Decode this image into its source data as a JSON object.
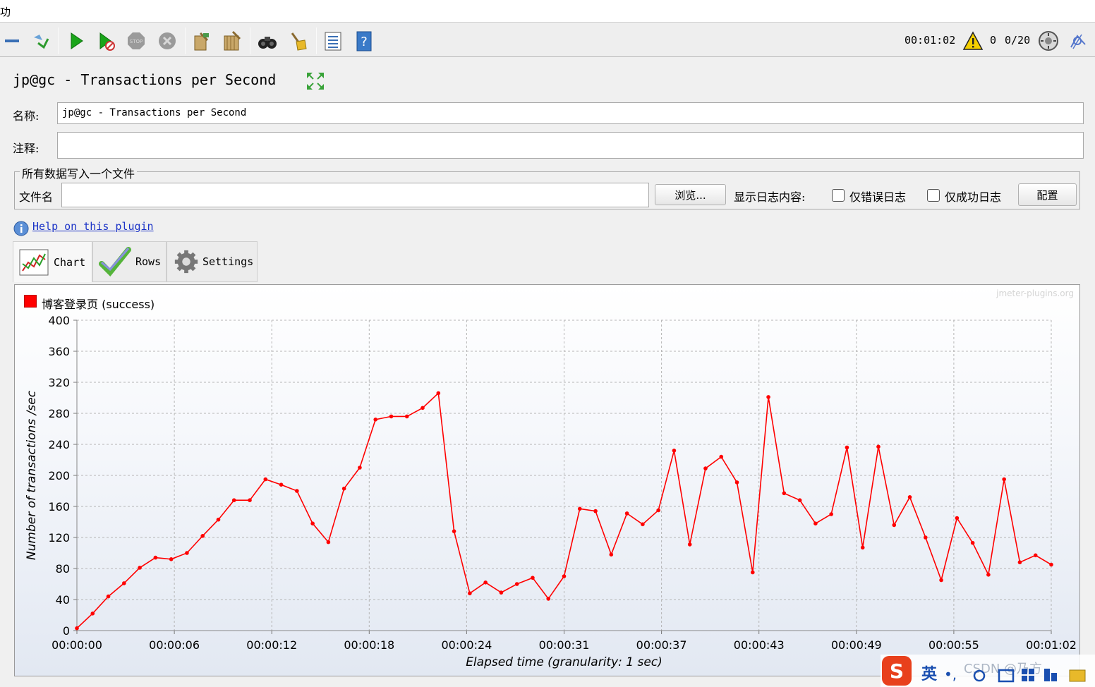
{
  "window": {
    "title_fragment": "功"
  },
  "toolbar": {
    "icons": [
      "collapse-icon",
      "toggle-icon",
      "start-icon",
      "start-no-pause-icon",
      "stop-icon",
      "shutdown-icon",
      "clear-icon",
      "clear-all-icon",
      "search-icon",
      "reset-search-icon",
      "function-helper-icon",
      "help-icon"
    ],
    "elapsed_time": "00:01:02",
    "warning_count": "0",
    "threads": "0/20"
  },
  "panel": {
    "title": "jp@gc - Transactions per Second",
    "name_label": "名称:",
    "name_value": "jp@gc - Transactions per Second",
    "comment_label": "注释:",
    "comment_value": ""
  },
  "file_group": {
    "legend": "所有数据写入一个文件",
    "filename_label": "文件名",
    "filename_value": "",
    "browse_label": "浏览...",
    "log_display_label": "显示日志内容:",
    "errors_only_label": "仅错误日志",
    "errors_only_checked": false,
    "success_only_label": "仅成功日志",
    "success_only_checked": false,
    "configure_label": "配置"
  },
  "help": {
    "link_text": "Help on this plugin"
  },
  "tabs": [
    {
      "label": "Chart",
      "icon": "chart-icon",
      "active": true
    },
    {
      "label": "Rows",
      "icon": "checkmark-icon",
      "active": false
    },
    {
      "label": "Settings",
      "icon": "gear-icon",
      "active": false
    }
  ],
  "chart_data": {
    "type": "line",
    "watermark": "jmeter-plugins.org",
    "xlabel": "Elapsed time (granularity: 1 sec)",
    "ylabel": "Number of transactions /sec",
    "ylim": [
      0,
      400
    ],
    "xlim": [
      0,
      62
    ],
    "y_ticks": [
      "0",
      "40",
      "80",
      "120",
      "160",
      "200",
      "240",
      "280",
      "320",
      "360",
      "400"
    ],
    "x_ticks": [
      {
        "x": 0,
        "label": "00:00:00"
      },
      {
        "x": 6.2,
        "label": "00:00:06"
      },
      {
        "x": 12.4,
        "label": "00:00:12"
      },
      {
        "x": 18.6,
        "label": "00:00:18"
      },
      {
        "x": 24.8,
        "label": "00:00:24"
      },
      {
        "x": 31,
        "label": "00:00:31"
      },
      {
        "x": 37.2,
        "label": "00:00:37"
      },
      {
        "x": 43.4,
        "label": "00:00:43"
      },
      {
        "x": 49.6,
        "label": "00:00:49"
      },
      {
        "x": 55.8,
        "label": "00:00:55"
      },
      {
        "x": 62,
        "label": "00:01:02"
      }
    ],
    "grid": true,
    "legend_position": "top-left",
    "series": [
      {
        "name": "博客登录页 (success)",
        "color": "#ff0000",
        "values": [
          3,
          22,
          44,
          61,
          81,
          94,
          92,
          100,
          122,
          143,
          168,
          168,
          195,
          188,
          180,
          138,
          114,
          183,
          210,
          272,
          276,
          276,
          287,
          306,
          128,
          48,
          62,
          49,
          60,
          68,
          41,
          70,
          157,
          154,
          98,
          151,
          137,
          155,
          232,
          111,
          209,
          224,
          191,
          75,
          301,
          177,
          168,
          138,
          150,
          236,
          107,
          237,
          136,
          172,
          120,
          65,
          145,
          113,
          72,
          195,
          88,
          97,
          85
        ]
      }
    ]
  },
  "ime": {
    "logo": "S",
    "mode": "英",
    "punct": "•,",
    "watermark": "CSDN @乃方"
  }
}
